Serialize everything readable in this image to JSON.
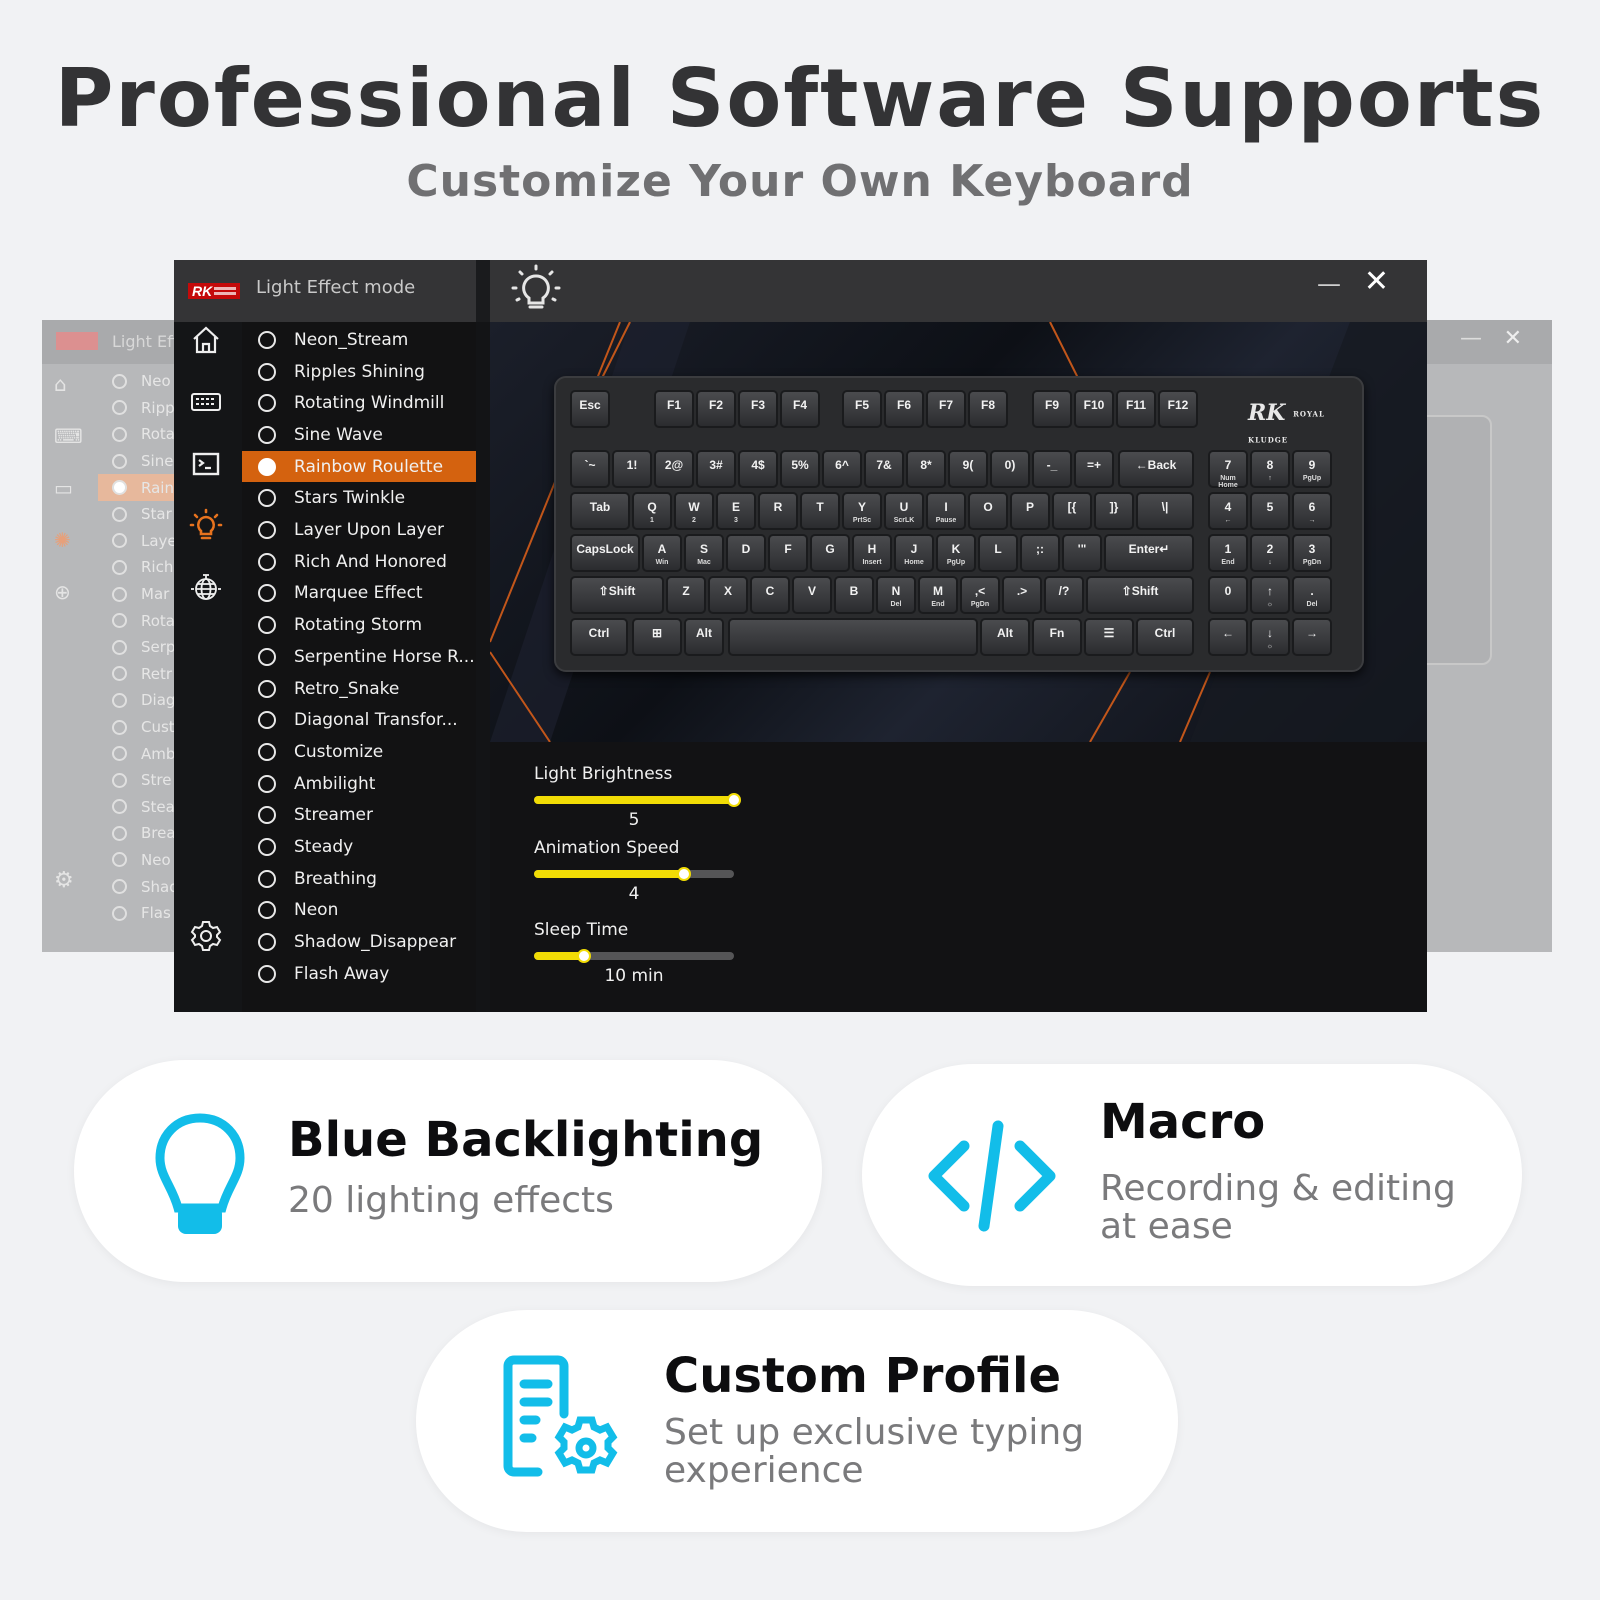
{
  "hero": {
    "title": "Professional Software Supports",
    "subtitle": "Customize Your Own Keyboard"
  },
  "app": {
    "title": "Light Effect mode",
    "logo": "RK",
    "window_controls": {
      "minimize": "—",
      "close": "✕"
    },
    "nav": [
      {
        "name": "home",
        "icon": "home-icon"
      },
      {
        "name": "keyboard",
        "icon": "keyboard-icon"
      },
      {
        "name": "macro",
        "icon": "terminal-icon"
      },
      {
        "name": "lighting",
        "icon": "lightbulb-icon",
        "active": true
      },
      {
        "name": "globe",
        "icon": "globe-icon"
      },
      {
        "name": "settings",
        "icon": "gear-icon"
      }
    ],
    "accent_color": "#d4620f",
    "slider_color": "#f1dc05",
    "effects": [
      "Neon_Stream",
      "Ripples Shining",
      "Rotating Windmill",
      "Sine Wave",
      "Rainbow Roulette",
      "Stars Twinkle",
      "Layer Upon Layer",
      "Rich And Honored",
      "Marquee Effect",
      "Rotating Storm",
      "Serpentine Horse R...",
      "Retro_Snake",
      "Diagonal Transfor...",
      "Customize",
      "Ambilight",
      "Streamer",
      "Steady",
      "Breathing",
      "Neon",
      "Shadow_Disappear",
      "Flash Away"
    ],
    "selected_effect": "Rainbow Roulette",
    "ghost_effects": [
      "Neo",
      "Ripp",
      "Rota",
      "Sine",
      "Rain",
      "Star",
      "Laye",
      "Rich",
      "Mar",
      "Rota",
      "Serp",
      "Retr",
      "Diag",
      "Cust",
      "Amb",
      "Stre",
      "Stea",
      "Brea",
      "Neo",
      "Shad",
      "Flas"
    ],
    "ghost_title": "Light Effe",
    "sliders": [
      {
        "label": "Light Brightness",
        "value": "5",
        "fraction": 1.0
      },
      {
        "label": "Animation Speed",
        "value": "4",
        "fraction": 0.75
      },
      {
        "label": "Sleep Time",
        "value": "10 min",
        "fraction": 0.25
      }
    ],
    "keyboard": {
      "brand": "RK",
      "brand_sub": "ROYAL KLUDGE",
      "rows": [
        [
          [
            "Esc",
            ""
          ],
          [
            "F1",
            ""
          ],
          [
            "F2",
            ""
          ],
          [
            "F3",
            ""
          ],
          [
            "F4",
            ""
          ],
          [
            "F5",
            ""
          ],
          [
            "F6",
            ""
          ],
          [
            "F7",
            ""
          ],
          [
            "F8",
            ""
          ],
          [
            "F9",
            ""
          ],
          [
            "F10",
            ""
          ],
          [
            "F11",
            ""
          ],
          [
            "F12",
            ""
          ]
        ],
        [
          [
            "`~",
            ""
          ],
          [
            "1!",
            ""
          ],
          [
            "2@",
            ""
          ],
          [
            "3#",
            ""
          ],
          [
            "4$",
            ""
          ],
          [
            "5%",
            ""
          ],
          [
            "6^",
            ""
          ],
          [
            "7&",
            ""
          ],
          [
            "8*",
            ""
          ],
          [
            "9(",
            ""
          ],
          [
            "0)",
            ""
          ],
          [
            "-_",
            ""
          ],
          [
            "=+",
            ""
          ],
          [
            "←Back",
            ""
          ],
          [
            "7",
            "Num Home"
          ],
          [
            "8",
            "↑"
          ],
          [
            "9",
            "PgUp"
          ]
        ],
        [
          [
            "Tab",
            ""
          ],
          [
            "Q",
            "1"
          ],
          [
            "W",
            "2"
          ],
          [
            "E",
            "3"
          ],
          [
            "R",
            ""
          ],
          [
            "T",
            ""
          ],
          [
            "Y",
            "PrtSc"
          ],
          [
            "U",
            "ScrLK"
          ],
          [
            "I",
            "Pause"
          ],
          [
            "O",
            ""
          ],
          [
            "P",
            ""
          ],
          [
            "[{",
            ""
          ],
          [
            "]}",
            ""
          ],
          [
            "\\|",
            ""
          ],
          [
            "4",
            "←"
          ],
          [
            "5",
            ""
          ],
          [
            "6",
            "→"
          ]
        ],
        [
          [
            "CapsLock",
            ""
          ],
          [
            "A",
            "Win"
          ],
          [
            "S",
            "Mac"
          ],
          [
            "D",
            ""
          ],
          [
            "F",
            ""
          ],
          [
            "G",
            ""
          ],
          [
            "H",
            "Insert"
          ],
          [
            "J",
            "Home"
          ],
          [
            "K",
            "PgUp"
          ],
          [
            "L",
            ""
          ],
          [
            ";:",
            ""
          ],
          [
            "'\"",
            ""
          ],
          [
            "Enter↵",
            ""
          ],
          [
            "1",
            "End"
          ],
          [
            "2",
            "↓"
          ],
          [
            "3",
            "PgDn"
          ]
        ],
        [
          [
            "⇧Shift",
            ""
          ],
          [
            "Z",
            ""
          ],
          [
            "X",
            ""
          ],
          [
            "C",
            ""
          ],
          [
            "V",
            ""
          ],
          [
            "B",
            ""
          ],
          [
            "N",
            "Del"
          ],
          [
            "M",
            "End"
          ],
          [
            ",<",
            "PgDn"
          ],
          [
            ".>",
            ""
          ],
          [
            "/?",
            ""
          ],
          [
            "⇧Shift",
            ""
          ],
          [
            "0",
            ""
          ],
          [
            "↑",
            "☼"
          ],
          [
            ".",
            "Del"
          ]
        ],
        [
          [
            "Ctrl",
            ""
          ],
          [
            "⊞",
            ""
          ],
          [
            "Alt",
            ""
          ],
          [
            "",
            ""
          ],
          [
            "Alt",
            ""
          ],
          [
            "Fn",
            ""
          ],
          [
            "☰",
            ""
          ],
          [
            "Ctrl",
            ""
          ],
          [
            "←",
            ""
          ],
          [
            "↓",
            "☼"
          ],
          [
            "→",
            ""
          ]
        ]
      ]
    }
  },
  "features": [
    {
      "title": "Blue Backlighting",
      "desc": [
        "20 lighting effects"
      ],
      "icon": "lightbulb-icon"
    },
    {
      "title": "Macro",
      "desc": [
        "Recording & editing",
        "at ease"
      ],
      "icon": "code-icon"
    },
    {
      "title": "Custom Profile",
      "desc": [
        "Set up exclusive typing",
        "experience"
      ],
      "icon": "profile-gear-icon"
    }
  ],
  "feature_icon_color": "#12bde9"
}
